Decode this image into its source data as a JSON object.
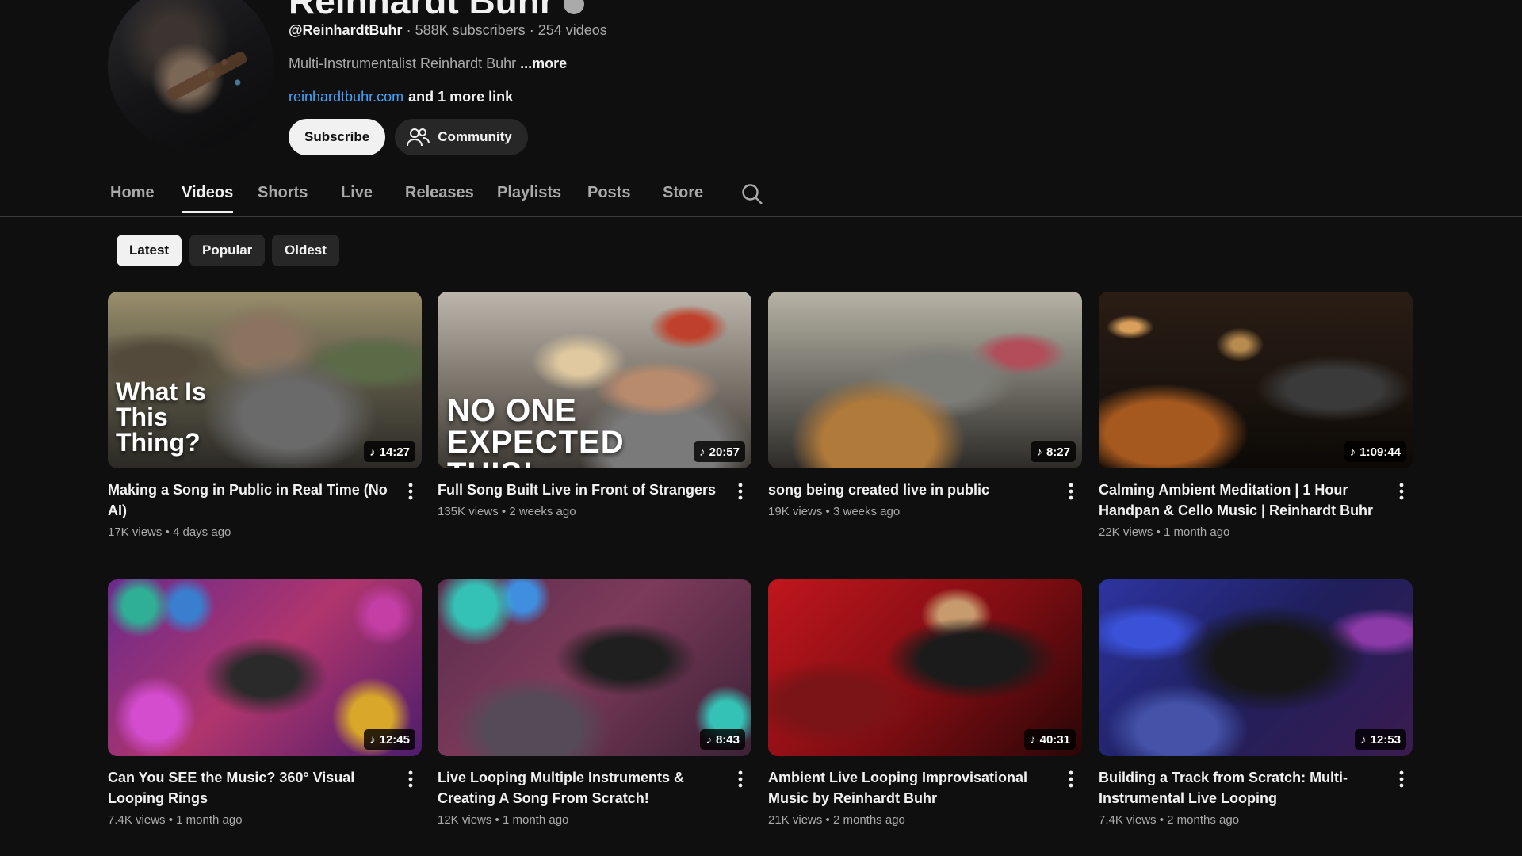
{
  "channel": {
    "name": "Reinhardt Buhr",
    "handle": "@ReinhardtBuhr",
    "subscribers": "588K subscribers",
    "videos": "254 videos",
    "description": "Multi-Instrumentalist Reinhardt Buhr",
    "more_label": "...more",
    "link": "reinhardtbuhr.com",
    "more_links": "and 1 more link",
    "subscribe_label": "Subscribe",
    "community_label": "Community"
  },
  "tabs": [
    {
      "label": "Home"
    },
    {
      "label": "Videos"
    },
    {
      "label": "Shorts"
    },
    {
      "label": "Live"
    },
    {
      "label": "Releases"
    },
    {
      "label": "Playlists"
    },
    {
      "label": "Posts"
    },
    {
      "label": "Store"
    }
  ],
  "active_tab": "Videos",
  "chips": [
    {
      "label": "Latest"
    },
    {
      "label": "Popular"
    },
    {
      "label": "Oldest"
    }
  ],
  "videos": [
    {
      "title": "Making a Song in Public in Real Time (No AI)",
      "views": "17K views",
      "age": "4 days ago",
      "duration": "14:27",
      "overlay": "What Is This Thing?"
    },
    {
      "title": "Full Song Built Live in Front of Strangers",
      "views": "135K views",
      "age": "2 weeks ago",
      "duration": "20:57",
      "overlay": "NO ONE EXPECTED THIS!"
    },
    {
      "title": "song being created live in public",
      "views": "19K views",
      "age": "3 weeks ago",
      "duration": "8:27"
    },
    {
      "title": "Calming Ambient Meditation | 1 Hour Handpan & Cello Music | Reinhardt Buhr",
      "views": "22K views",
      "age": "1 month ago",
      "duration": "1:09:44"
    },
    {
      "title": "Can You SEE the Music? 360° Visual Looping Rings",
      "views": "7.4K views",
      "age": "1 month ago",
      "duration": "12:45"
    },
    {
      "title": "Live Looping Multiple Instruments & Creating A Song From Scratch!",
      "views": "12K views",
      "age": "1 month ago",
      "duration": "8:43"
    },
    {
      "title": "Ambient Live Looping Improvisational Music by Reinhardt Buhr",
      "views": "21K views",
      "age": "2 months ago",
      "duration": "40:31"
    },
    {
      "title": "Building a Track from Scratch: Multi-Instrumental Live Looping",
      "views": "7.4K views",
      "age": "2 months ago",
      "duration": "12:53"
    }
  ],
  "separator": "•",
  "dot": "·",
  "icons": {
    "community": "community-icon",
    "search": "search-icon",
    "more": "more-vert-icon",
    "duration": "music-note-icon",
    "verified": "verified-icon"
  },
  "colors": {
    "background": "#0f0f0f",
    "text": "#f1f1f1",
    "secondary": "#aaaaaa",
    "link": "#3ea6ff",
    "chip": "#272727"
  }
}
